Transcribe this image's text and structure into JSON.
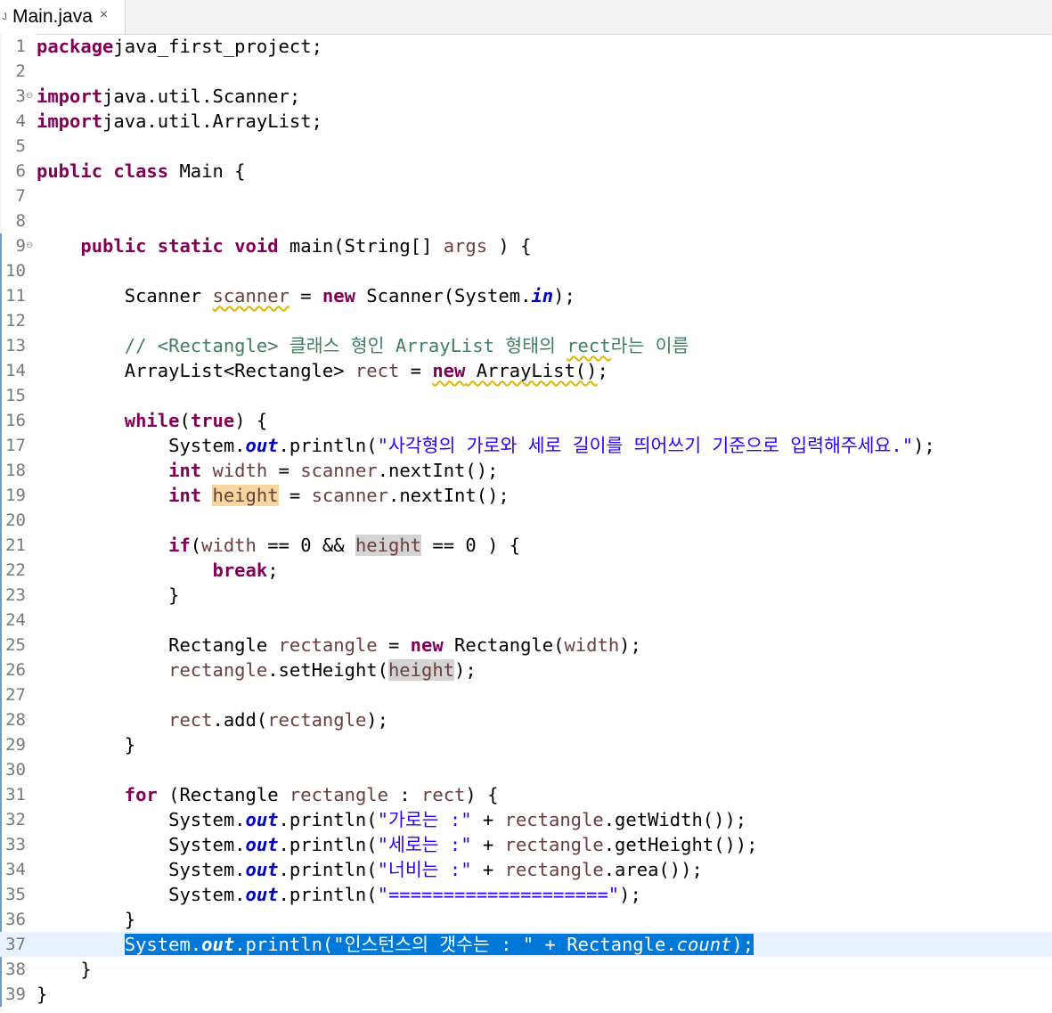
{
  "tab": {
    "icon": "java-file-icon",
    "title": "Main.java",
    "close": "×"
  },
  "lines": [
    {
      "n": "1",
      "fold": "",
      "current": false,
      "tokens": [
        [
          "kw",
          "package"
        ],
        [
          "",
          "java_first_project;"
        ]
      ]
    },
    {
      "n": "2",
      "fold": "",
      "current": false,
      "tokens": []
    },
    {
      "n": "3",
      "fold": "⊖",
      "current": false,
      "tokens": [
        [
          "kw",
          "import"
        ],
        [
          "",
          "java.util.Scanner;"
        ]
      ]
    },
    {
      "n": "4",
      "fold": "",
      "current": false,
      "tokens": [
        [
          "kw",
          "import"
        ],
        [
          "",
          "java.util.ArrayList;"
        ]
      ]
    },
    {
      "n": "5",
      "fold": "",
      "current": false,
      "tokens": []
    },
    {
      "n": "6",
      "fold": "",
      "current": false,
      "tokens": [
        [
          "kw",
          "public"
        ],
        [
          "",
          " "
        ],
        [
          "kw",
          "class"
        ],
        [
          "",
          " Main {"
        ]
      ]
    },
    {
      "n": "7",
      "fold": "",
      "current": false,
      "tokens": []
    },
    {
      "n": "8",
      "fold": "",
      "current": false,
      "tokens": []
    },
    {
      "n": "9",
      "fold": "⊖",
      "current": false,
      "tokens": [
        [
          "",
          "    "
        ],
        [
          "kw",
          "public"
        ],
        [
          "",
          " "
        ],
        [
          "kw",
          "static"
        ],
        [
          "",
          " "
        ],
        [
          "kw",
          "void"
        ],
        [
          "",
          " main(String[] "
        ],
        [
          "var",
          "args"
        ],
        [
          "",
          " ) {"
        ]
      ]
    },
    {
      "n": "10",
      "fold": "",
      "current": false,
      "tokens": []
    },
    {
      "n": "11",
      "fold": "",
      "current": false,
      "tokens": [
        [
          "",
          "        Scanner "
        ],
        [
          "var warn",
          "scanner"
        ],
        [
          "",
          " = "
        ],
        [
          "kw",
          "new"
        ],
        [
          "",
          " Scanner(System."
        ],
        [
          "fld",
          "in"
        ],
        [
          "",
          ");"
        ]
      ]
    },
    {
      "n": "12",
      "fold": "",
      "current": false,
      "tokens": []
    },
    {
      "n": "13",
      "fold": "",
      "current": false,
      "tokens": [
        [
          "",
          "        "
        ],
        [
          "cm",
          "// <Rectangle> 클래스 형인 ArrayList 형태의 "
        ],
        [
          "cm warn",
          "rect"
        ],
        [
          "cm",
          "라는 이름"
        ]
      ]
    },
    {
      "n": "14",
      "fold": "",
      "current": false,
      "tokens": [
        [
          "",
          "        ArrayList<Rectangle> "
        ],
        [
          "var",
          "rect"
        ],
        [
          "",
          " = "
        ],
        [
          "kw warn",
          "new"
        ],
        [
          "warn",
          " ArrayList()"
        ],
        [
          "",
          ";"
        ]
      ]
    },
    {
      "n": "15",
      "fold": "",
      "current": false,
      "tokens": []
    },
    {
      "n": "16",
      "fold": "",
      "current": false,
      "tokens": [
        [
          "",
          "        "
        ],
        [
          "kw",
          "while"
        ],
        [
          "",
          "("
        ],
        [
          "kw",
          "true"
        ],
        [
          "",
          ") {"
        ]
      ]
    },
    {
      "n": "17",
      "fold": "",
      "current": false,
      "tokens": [
        [
          "",
          "            System."
        ],
        [
          "fld",
          "out"
        ],
        [
          "",
          ".println("
        ],
        [
          "str",
          "\"사각형의 가로와 세로 길이를 띄어쓰기 기준으로 입력해주세요.\""
        ],
        [
          "",
          ");"
        ]
      ]
    },
    {
      "n": "18",
      "fold": "",
      "current": false,
      "tokens": [
        [
          "",
          "            "
        ],
        [
          "kw",
          "int"
        ],
        [
          "",
          " "
        ],
        [
          "var",
          "width"
        ],
        [
          "",
          " = "
        ],
        [
          "var",
          "scanner"
        ],
        [
          "",
          ".nextInt();"
        ]
      ]
    },
    {
      "n": "19",
      "fold": "",
      "current": false,
      "tokens": [
        [
          "",
          "            "
        ],
        [
          "kw",
          "int"
        ],
        [
          "",
          " "
        ],
        [
          "var occ-w",
          "height"
        ],
        [
          "",
          " = "
        ],
        [
          "var",
          "scanner"
        ],
        [
          "",
          ".nextInt();"
        ]
      ]
    },
    {
      "n": "20",
      "fold": "",
      "current": false,
      "tokens": []
    },
    {
      "n": "21",
      "fold": "",
      "current": false,
      "tokens": [
        [
          "",
          "            "
        ],
        [
          "kw",
          "if"
        ],
        [
          "",
          "("
        ],
        [
          "var",
          "width"
        ],
        [
          "",
          " == 0 && "
        ],
        [
          "var occ-r",
          "height"
        ],
        [
          "",
          " == 0 ) {"
        ]
      ]
    },
    {
      "n": "22",
      "fold": "",
      "current": false,
      "tokens": [
        [
          "",
          "                "
        ],
        [
          "kw",
          "break"
        ],
        [
          "",
          ";"
        ]
      ]
    },
    {
      "n": "23",
      "fold": "",
      "current": false,
      "tokens": [
        [
          "",
          "            }"
        ]
      ]
    },
    {
      "n": "24",
      "fold": "",
      "current": false,
      "tokens": []
    },
    {
      "n": "25",
      "fold": "",
      "current": false,
      "tokens": [
        [
          "",
          "            Rectangle "
        ],
        [
          "var",
          "rectangle"
        ],
        [
          "",
          " = "
        ],
        [
          "kw",
          "new"
        ],
        [
          "",
          " Rectangle("
        ],
        [
          "var",
          "width"
        ],
        [
          "",
          ");"
        ]
      ]
    },
    {
      "n": "26",
      "fold": "",
      "current": false,
      "tokens": [
        [
          "",
          "            "
        ],
        [
          "var",
          "rectangle"
        ],
        [
          "",
          ".setHeight("
        ],
        [
          "var occ-r",
          "height"
        ],
        [
          "",
          ");"
        ]
      ]
    },
    {
      "n": "27",
      "fold": "",
      "current": false,
      "tokens": []
    },
    {
      "n": "28",
      "fold": "",
      "current": false,
      "tokens": [
        [
          "",
          "            "
        ],
        [
          "var",
          "rect"
        ],
        [
          "",
          ".add("
        ],
        [
          "var",
          "rectangle"
        ],
        [
          "",
          ");"
        ]
      ]
    },
    {
      "n": "29",
      "fold": "",
      "current": false,
      "tokens": [
        [
          "",
          "        }"
        ]
      ]
    },
    {
      "n": "30",
      "fold": "",
      "current": false,
      "tokens": []
    },
    {
      "n": "31",
      "fold": "",
      "current": false,
      "tokens": [
        [
          "",
          "        "
        ],
        [
          "kw",
          "for"
        ],
        [
          "",
          " (Rectangle "
        ],
        [
          "var",
          "rectangle"
        ],
        [
          "",
          " : "
        ],
        [
          "var",
          "rect"
        ],
        [
          "",
          ") {"
        ]
      ]
    },
    {
      "n": "32",
      "fold": "",
      "current": false,
      "tokens": [
        [
          "",
          "            System."
        ],
        [
          "fld",
          "out"
        ],
        [
          "",
          ".println("
        ],
        [
          "str",
          "\"가로는 :\""
        ],
        [
          "",
          " + "
        ],
        [
          "var",
          "rectangle"
        ],
        [
          "",
          ".getWidth());"
        ]
      ]
    },
    {
      "n": "33",
      "fold": "",
      "current": false,
      "tokens": [
        [
          "",
          "            System."
        ],
        [
          "fld",
          "out"
        ],
        [
          "",
          ".println("
        ],
        [
          "str",
          "\"세로는 :\""
        ],
        [
          "",
          " + "
        ],
        [
          "var",
          "rectangle"
        ],
        [
          "",
          ".getHeight());"
        ]
      ]
    },
    {
      "n": "34",
      "fold": "",
      "current": false,
      "tokens": [
        [
          "",
          "            System."
        ],
        [
          "fld",
          "out"
        ],
        [
          "",
          ".println("
        ],
        [
          "str",
          "\"너비는 :\""
        ],
        [
          "",
          " + "
        ],
        [
          "var",
          "rectangle"
        ],
        [
          "",
          ".area());"
        ]
      ]
    },
    {
      "n": "35",
      "fold": "",
      "current": false,
      "tokens": [
        [
          "",
          "            System."
        ],
        [
          "fld",
          "out"
        ],
        [
          "",
          ".println("
        ],
        [
          "str",
          "\"====================\""
        ],
        [
          "",
          ");"
        ]
      ]
    },
    {
      "n": "36",
      "fold": "",
      "current": false,
      "tokens": [
        [
          "",
          "        }"
        ]
      ]
    },
    {
      "n": "37",
      "fold": "",
      "current": true,
      "tokens": [
        [
          "",
          "        "
        ],
        [
          "sel",
          "System."
        ],
        [
          "sel fld",
          "out"
        ],
        [
          "sel",
          ".println("
        ],
        [
          "sel str",
          "\"인스턴스의 갯수는 : \""
        ],
        [
          "sel",
          " + Rectangle."
        ],
        [
          "sel it",
          "count"
        ],
        [
          "sel",
          ");"
        ]
      ]
    },
    {
      "n": "38",
      "fold": "",
      "current": false,
      "tokens": [
        [
          "",
          "    }"
        ]
      ]
    },
    {
      "n": "39",
      "fold": "",
      "current": false,
      "tokens": [
        [
          "",
          "}"
        ]
      ]
    }
  ]
}
